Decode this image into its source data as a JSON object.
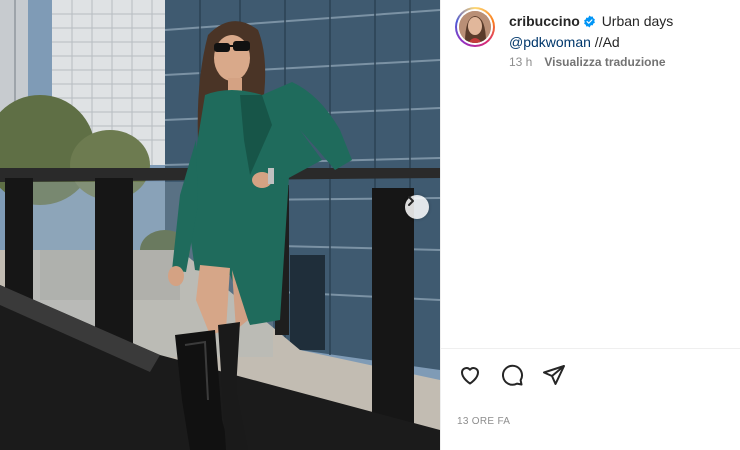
{
  "post": {
    "username": "cribuccino",
    "caption_text": "Urban days",
    "mention": "@pdkwoman",
    "caption_suffix": " //Ad",
    "time_ago": "13 h",
    "translate_label": "Visualizza traduzione",
    "timestamp": "13 ORE FA"
  },
  "icons": {
    "verified": "verified-badge-icon",
    "next": "chevron-right-icon",
    "like": "heart-icon",
    "comment": "comment-icon",
    "share": "paper-plane-icon"
  },
  "colors": {
    "verified": "#0095f6",
    "mention": "#00376b",
    "dress": "#1f6b5c",
    "muted_text": "#8e8e8e"
  }
}
